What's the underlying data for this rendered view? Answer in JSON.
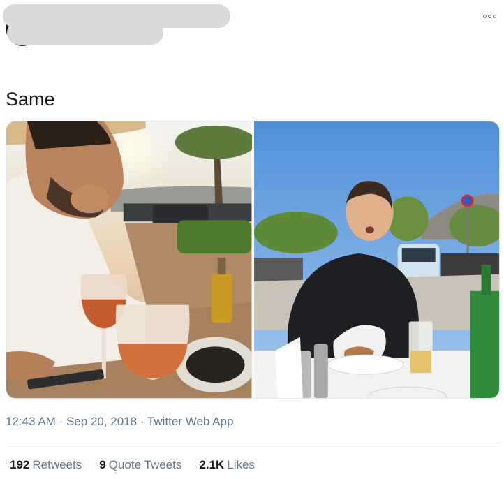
{
  "tweet": {
    "text": "Same",
    "timestamp": "12:43 AM",
    "separator": "·",
    "date": "Sep 20, 2018",
    "source": "Twitter Web App"
  },
  "stats": {
    "retweets_count": "192",
    "retweets_label": "Retweets",
    "quotes_count": "9",
    "quotes_label": "Quote Tweets",
    "likes_count": "2.1K",
    "likes_label": "Likes"
  },
  "icons": {
    "more": "more-options-icon"
  },
  "colors": {
    "text_primary": "#14171a",
    "text_secondary": "#657786",
    "redaction": "#d9d9d9"
  }
}
